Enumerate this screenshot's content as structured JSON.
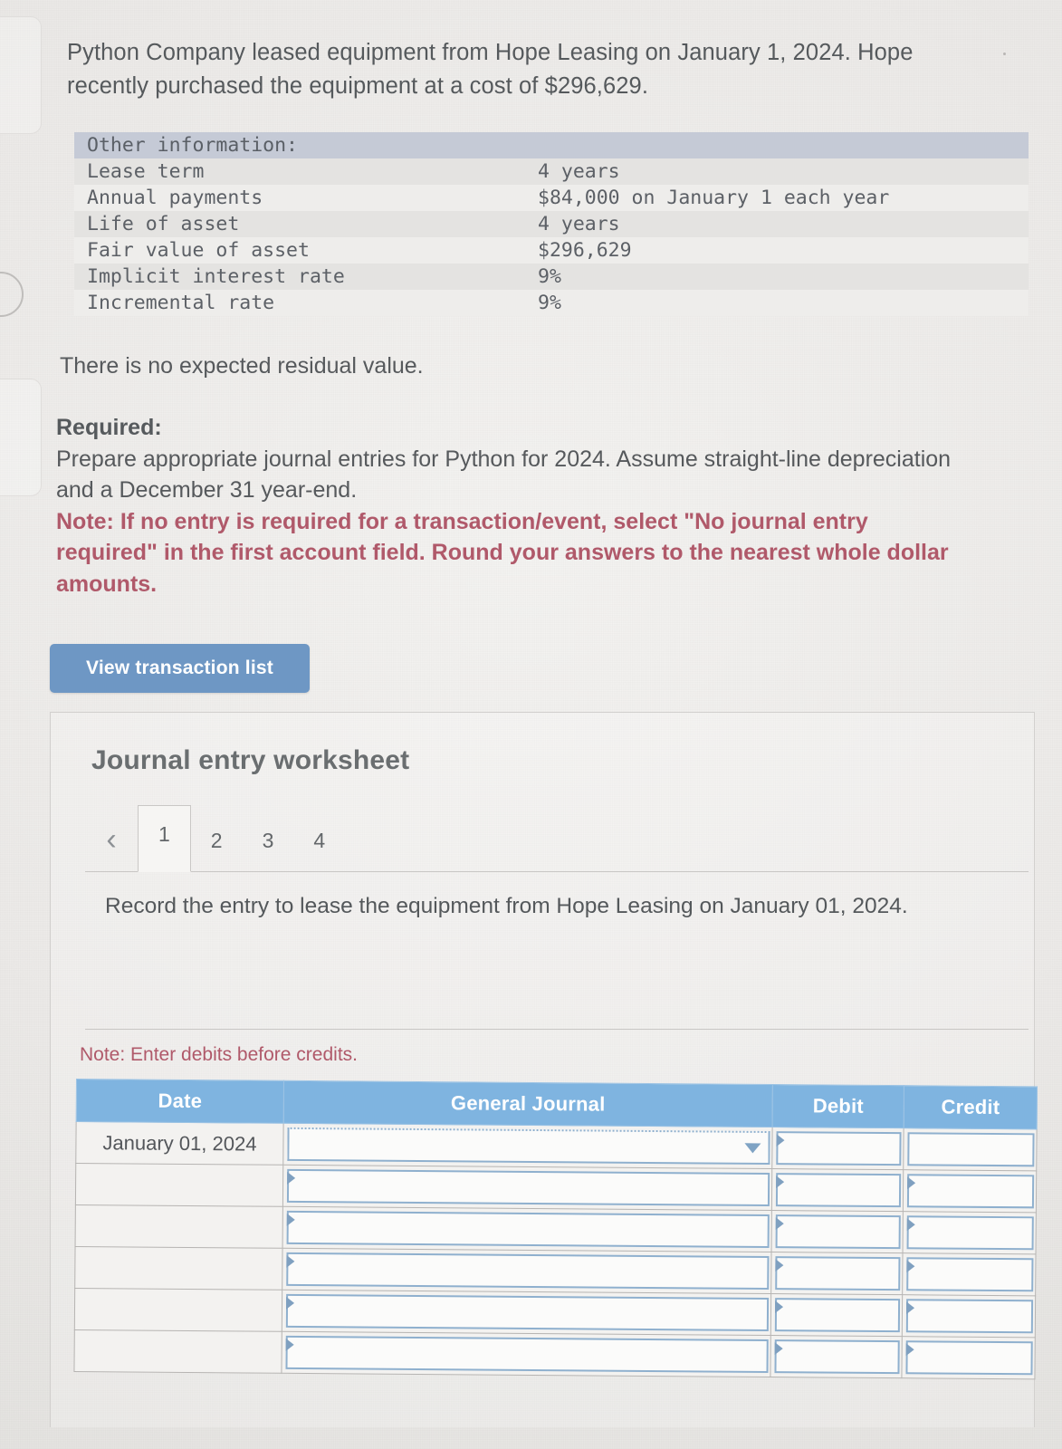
{
  "intro": {
    "paragraph": "Python Company leased equipment from Hope Leasing on January 1, 2024. Hope recently purchased the equipment at a cost of $296,629."
  },
  "other_information": {
    "heading": "Other information:",
    "rows": [
      {
        "label": "Lease term",
        "value": "4 years"
      },
      {
        "label": "Annual payments",
        "value": "$84,000 on January 1 each year"
      },
      {
        "label": "Life of asset",
        "value": "4 years"
      },
      {
        "label": "Fair value of asset",
        "value": "$296,629"
      },
      {
        "label": "Implicit interest rate",
        "value": "9%"
      },
      {
        "label": "Incremental rate",
        "value": "9%"
      }
    ]
  },
  "residual_note": "There is no expected residual value.",
  "required": {
    "title": "Required:",
    "body": "Prepare appropriate journal entries for Python for 2024. Assume straight-line depreciation and a December 31 year-end.",
    "note": "Note: If no entry is required for a transaction/event, select \"No journal entry required\" in the first account field. Round your answers to the nearest whole dollar amounts."
  },
  "view_transaction_button": "View transaction list",
  "worksheet": {
    "title": "Journal entry worksheet",
    "prev_icon": "‹",
    "tabs": [
      {
        "label": "1",
        "active": true
      },
      {
        "label": "2",
        "active": false
      },
      {
        "label": "3",
        "active": false
      },
      {
        "label": "4",
        "active": false
      }
    ],
    "instruction": "Record the entry to lease the equipment from Hope Leasing on January 01, 2024.",
    "debit_note": "Note: Enter debits before credits.",
    "table": {
      "columns": [
        "Date",
        "General Journal",
        "Debit",
        "Credit"
      ],
      "rows": [
        {
          "date": "January 01, 2024",
          "general_journal": "",
          "debit": "",
          "credit": "",
          "has_dropdown": true
        },
        {
          "date": "",
          "general_journal": "",
          "debit": "",
          "credit": "",
          "has_dropdown": false
        },
        {
          "date": "",
          "general_journal": "",
          "debit": "",
          "credit": "",
          "has_dropdown": false
        },
        {
          "date": "",
          "general_journal": "",
          "debit": "",
          "credit": "",
          "has_dropdown": false
        },
        {
          "date": "",
          "general_journal": "",
          "debit": "",
          "credit": "",
          "has_dropdown": false
        },
        {
          "date": "",
          "general_journal": "",
          "debit": "",
          "credit": "",
          "has_dropdown": false
        }
      ]
    }
  },
  "colors": {
    "button_blue": "#6e97c4",
    "table_header_blue": "#7fb4e0",
    "note_red": "#b0596a",
    "info_band": "#c5cad6",
    "input_border": "#8fb0ce"
  }
}
